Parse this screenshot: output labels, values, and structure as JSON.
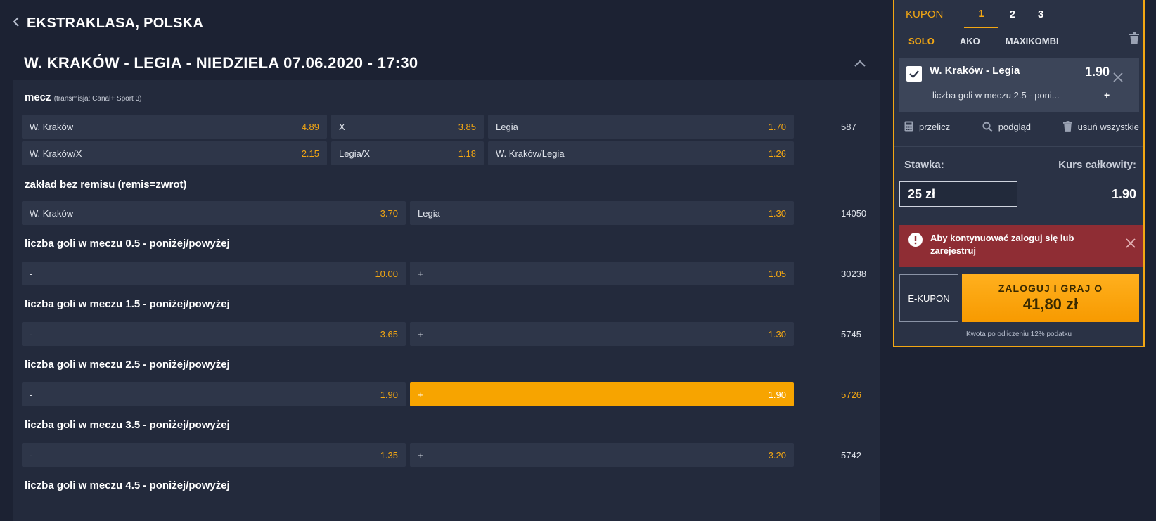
{
  "breadcrumb": {
    "back_icon": "chevron-left-icon",
    "label": "EKSTRAKLASA, POLSKA"
  },
  "match": {
    "title": "W. KRAKÓW - LEGIA - NIEDZIELA 07.06.2020 - 17:30",
    "collapse_icon": "chevron-up-icon"
  },
  "markets": [
    {
      "title": "mecz",
      "subtitle": "(transmisja: Canal+ Sport 3)",
      "count": "587",
      "rows": [
        [
          {
            "label": "W. Kraków",
            "odd": "4.89"
          },
          {
            "label": "X",
            "odd": "3.85"
          },
          {
            "label": "Legia",
            "odd": "1.70"
          }
        ],
        [
          {
            "label": "W. Kraków/X",
            "odd": "2.15"
          },
          {
            "label": "Legia/X",
            "odd": "1.18"
          },
          {
            "label": "W. Kraków/Legia",
            "odd": "1.26"
          }
        ]
      ]
    },
    {
      "title": "zakład bez remisu (remis=zwrot)",
      "count": "14050",
      "options": [
        {
          "label": "W. Kraków",
          "odd": "3.70"
        },
        {
          "label": "Legia",
          "odd": "1.30"
        }
      ]
    },
    {
      "title": "liczba goli w meczu 0.5 - poniżej/powyżej",
      "count": "30238",
      "options": [
        {
          "label": "-",
          "odd": "10.00"
        },
        {
          "label": "+",
          "odd": "1.05"
        }
      ]
    },
    {
      "title": "liczba goli w meczu 1.5 - poniżej/powyżej",
      "count": "5745",
      "options": [
        {
          "label": "-",
          "odd": "3.65"
        },
        {
          "label": "+",
          "odd": "1.30"
        }
      ]
    },
    {
      "title": "liczba goli w meczu 2.5 - poniżej/powyżej",
      "count": "5726",
      "options": [
        {
          "label": "-",
          "odd": "1.90"
        },
        {
          "label": "+",
          "odd": "1.90",
          "selected": true
        }
      ]
    },
    {
      "title": "liczba goli w meczu 3.5 - poniżej/powyżej",
      "count": "5742",
      "options": [
        {
          "label": "-",
          "odd": "1.35"
        },
        {
          "label": "+",
          "odd": "3.20"
        }
      ]
    },
    {
      "title": "liczba goli w meczu 4.5 - poniżej/powyżej"
    }
  ],
  "coupon": {
    "label": "KUPON",
    "tabs": [
      "1",
      "2",
      "3"
    ],
    "types": [
      "SOLO",
      "AKO",
      "MAXIKOMBI"
    ],
    "bet": {
      "name": "W. Kraków - Legia",
      "odd": "1.90",
      "desc": "liczba goli w meczu 2.5 - poni...",
      "pick": "+"
    },
    "actions": {
      "recalc": "przelicz",
      "preview": "podgląd",
      "remove_all": "usuń wszystkie"
    },
    "stake_label": "Stawka:",
    "stake_value": "25 zł",
    "total_label": "Kurs całkowity:",
    "total_value": "1.90",
    "alert": "Aby kontynuować zaloguj się lub zarejestruj",
    "ekupon": "E-KUPON",
    "play_label": "ZALOGUJ I GRAJ O",
    "play_amount": "41,80 zł",
    "tax_note": "Kwota po odliczeniu 12% podatku"
  },
  "colors": {
    "accent": "#f3a713",
    "background": "#1c2233",
    "panel": "#232a3c",
    "alert": "#8f2d34"
  }
}
